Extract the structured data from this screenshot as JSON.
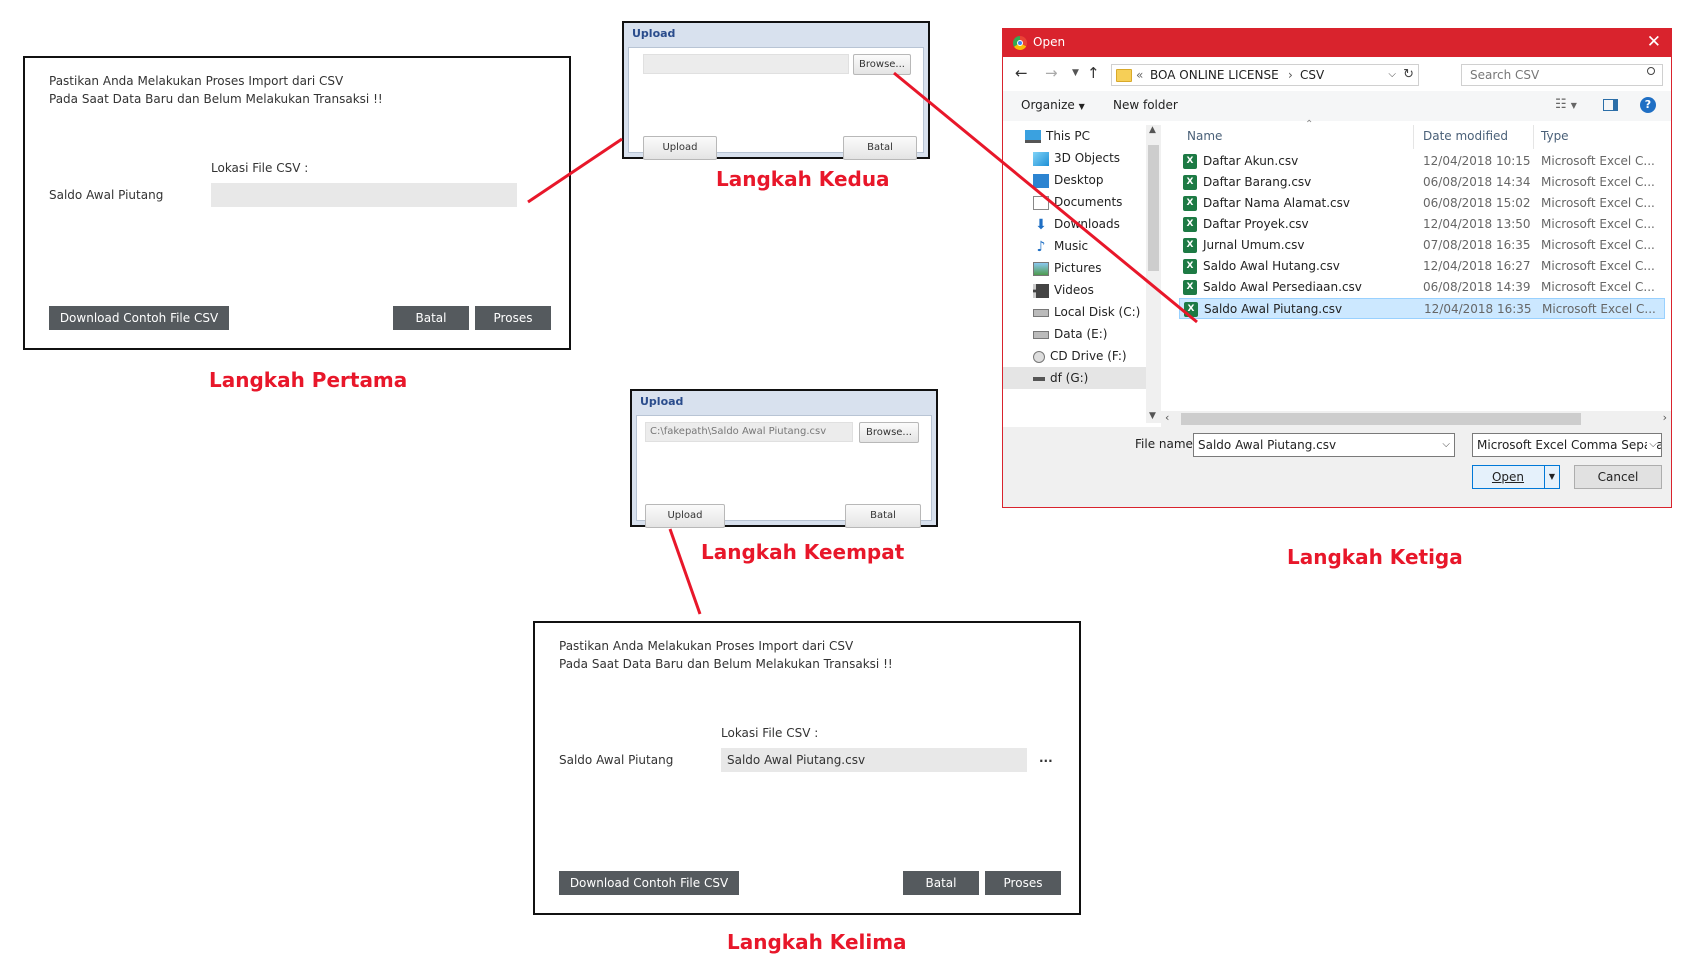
{
  "step_labels": {
    "first": "Langkah Pertama",
    "second": "Langkah Kedua",
    "third": "Langkah Ketiga",
    "fourth": "Langkah Keempat",
    "fifth": "Langkah Kelima"
  },
  "import_form_empty": {
    "notice_line1": "Pastikan Anda Melakukan Proses Import dari CSV",
    "notice_line2": "Pada Saat Data Baru dan Belum Melakukan Transaksi !!",
    "file_location_label": "Lokasi File CSV :",
    "field_label": "Saldo Awal Piutang",
    "file_value": "",
    "download_button": "Download Contoh File CSV",
    "cancel_button": "Batal",
    "process_button": "Proses"
  },
  "upload_dialog_empty": {
    "title": "Upload",
    "path_value": "",
    "browse_button": "Browse...",
    "upload_button": "Upload",
    "cancel_button": "Batal"
  },
  "file_open_dialog": {
    "title": "Open",
    "path_prefix": "«",
    "path": [
      "BOA ONLINE LICENSE",
      "CSV"
    ],
    "search_placeholder": "Search CSV",
    "organize_label": "Organize",
    "new_folder_label": "New folder",
    "nav_items": [
      {
        "label": "This PC",
        "icon": "monitor-icon"
      },
      {
        "label": "3D Objects",
        "icon": "cube-icon"
      },
      {
        "label": "Desktop",
        "icon": "desktop-icon"
      },
      {
        "label": "Documents",
        "icon": "document-icon"
      },
      {
        "label": "Downloads",
        "icon": "download-icon"
      },
      {
        "label": "Music",
        "icon": "music-icon"
      },
      {
        "label": "Pictures",
        "icon": "pictures-icon"
      },
      {
        "label": "Videos",
        "icon": "video-icon"
      },
      {
        "label": "Local Disk (C:)",
        "icon": "drive-icon"
      },
      {
        "label": "Data (E:)",
        "icon": "drive-icon"
      },
      {
        "label": "CD Drive (F:)",
        "icon": "cd-drive-icon"
      },
      {
        "label": "df (G:)",
        "icon": "drive-icon"
      }
    ],
    "columns": {
      "name": "Name",
      "date": "Date modified",
      "type": "Type"
    },
    "files": [
      {
        "name": "Daftar Akun.csv",
        "date": "12/04/2018 10:15",
        "type": "Microsoft Excel C..."
      },
      {
        "name": "Daftar Barang.csv",
        "date": "06/08/2018 14:34",
        "type": "Microsoft Excel C..."
      },
      {
        "name": "Daftar Nama Alamat.csv",
        "date": "06/08/2018 15:02",
        "type": "Microsoft Excel C..."
      },
      {
        "name": "Daftar Proyek.csv",
        "date": "12/04/2018 13:50",
        "type": "Microsoft Excel C..."
      },
      {
        "name": "Jurnal Umum.csv",
        "date": "07/08/2018 16:35",
        "type": "Microsoft Excel C..."
      },
      {
        "name": "Saldo Awal Hutang.csv",
        "date": "12/04/2018 16:27",
        "type": "Microsoft Excel C..."
      },
      {
        "name": "Saldo Awal Persediaan.csv",
        "date": "06/08/2018 14:39",
        "type": "Microsoft Excel C..."
      },
      {
        "name": "Saldo Awal Piutang.csv",
        "date": "12/04/2018 16:35",
        "type": "Microsoft Excel C..."
      }
    ],
    "selected_file_index": 7,
    "file_name_label": "File name:",
    "file_name_value": "Saldo Awal Piutang.csv",
    "file_type_value": "Microsoft Excel Comma Separa",
    "open_button": "Open",
    "cancel_button": "Cancel",
    "title_color": "#d9232d",
    "selection_color": "#cce8ff"
  },
  "upload_dialog_filled": {
    "title": "Upload",
    "path_value": "C:\\fakepath\\Saldo Awal Piutang.csv",
    "browse_button": "Browse...",
    "upload_button": "Upload",
    "cancel_button": "Batal"
  },
  "import_form_filled": {
    "notice_line1": "Pastikan Anda Melakukan Proses Import dari CSV",
    "notice_line2": "Pada Saat Data Baru dan Belum Melakukan Transaksi !!",
    "file_location_label": "Lokasi File CSV :",
    "field_label": "Saldo Awal Piutang",
    "file_value": "Saldo Awal Piutang.csv",
    "ellipsis": "...",
    "download_button": "Download Contoh File CSV",
    "cancel_button": "Batal",
    "process_button": "Proses"
  },
  "colors": {
    "step_label": "#e8172a",
    "connector": "#e8172a",
    "dark_button": "#555a5e",
    "upload_title": "#2a4c8c"
  }
}
